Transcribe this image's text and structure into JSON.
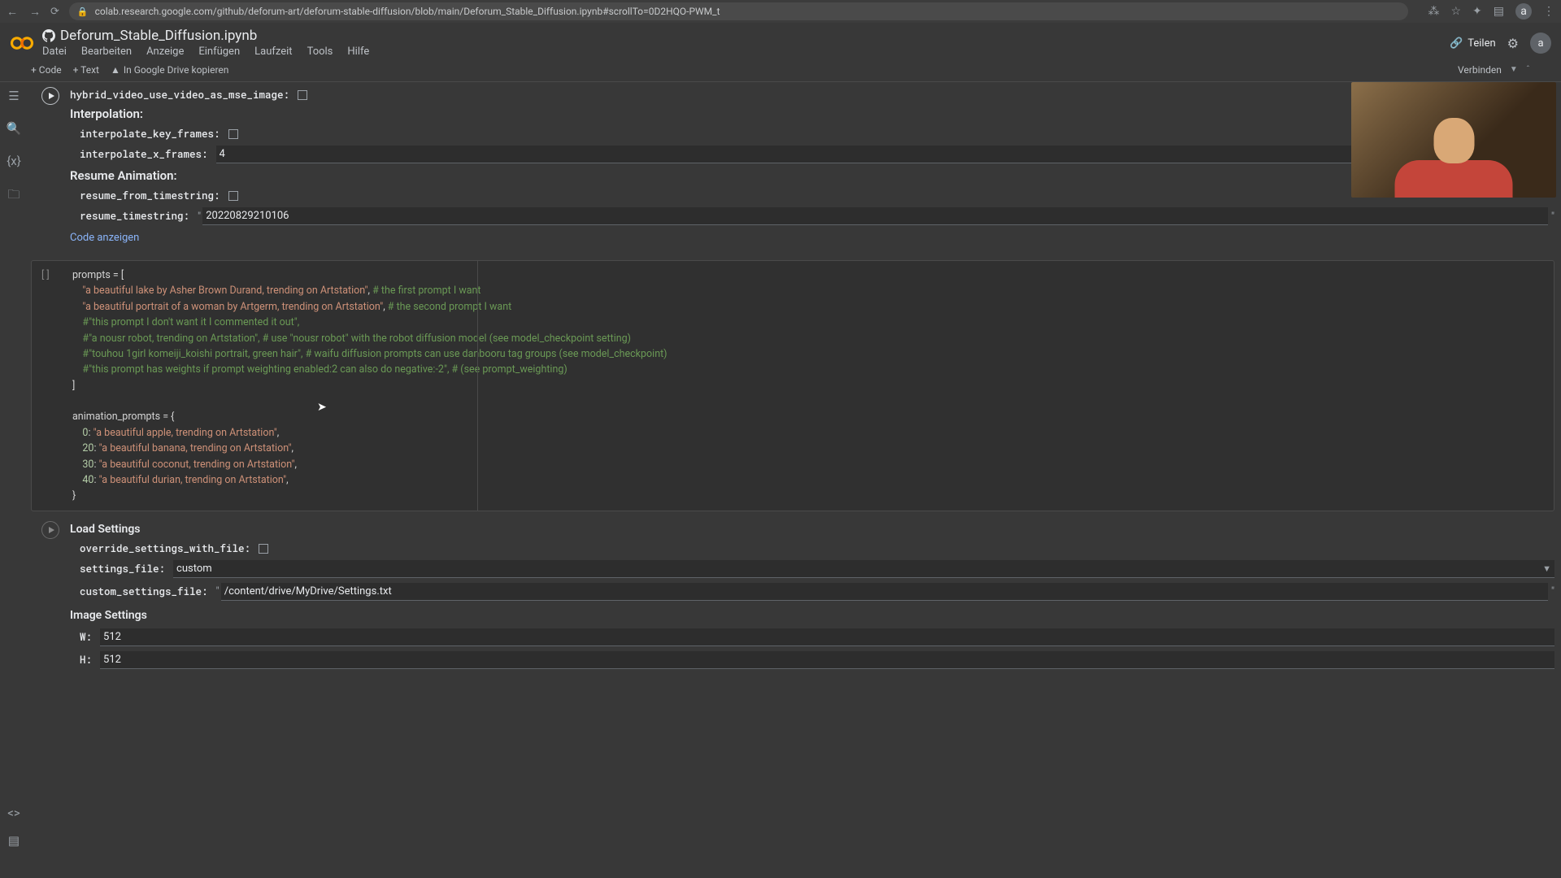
{
  "browser": {
    "url": "colab.research.google.com/github/deforum-art/deforum-stable-diffusion/blob/main/Deforum_Stable_Diffusion.ipynb#scrollTo=0D2HQO-PWM_t",
    "avatar": "a"
  },
  "colab": {
    "title": "Deforum_Stable_Diffusion.ipynb",
    "menu": [
      "Datei",
      "Bearbeiten",
      "Anzeige",
      "Einfügen",
      "Laufzeit",
      "Tools",
      "Hilfe"
    ],
    "share": "Teilen",
    "avatar": "a"
  },
  "toolbar": {
    "code": "+ Code",
    "text": "+ Text",
    "copy_drive": "In Google Drive kopieren",
    "connect": "Verbinden"
  },
  "form1": {
    "hybrid_label": "hybrid_video_use_video_as_mse_image:",
    "interpolation_heading": "Interpolation:",
    "interpolate_key_frames_label": "interpolate_key_frames:",
    "interpolate_x_frames_label": "interpolate_x_frames:",
    "interpolate_x_frames_value": "4",
    "resume_heading": "Resume Animation:",
    "resume_from_timestring_label": "resume_from_timestring:",
    "resume_timestring_label": "resume_timestring:",
    "resume_timestring_value": "20220829210106",
    "code_link": "Code anzeigen"
  },
  "code_cell": {
    "gutter": "[ ]",
    "l1a": "prompts ",
    "l1b": "=",
    "l1c": " [",
    "l2a": "\"a beautiful lake by Asher Brown Durand, trending on Artstation\"",
    "l2b": ", ",
    "l2c": "# the first prompt I want",
    "l3a": "\"a beautiful portrait of a woman by Artgerm, trending on Artstation\"",
    "l3b": ", ",
    "l3c": "# the second prompt I want",
    "l4": "#\"this prompt I don't want it I commented it out\",",
    "l5": "#\"a nousr robot, trending on Artstation\", # use \"nousr robot\" with the robot diffusion model (see model_checkpoint setting)",
    "l6": "#\"touhou 1girl komeiji_koishi portrait, green hair\", # waifu diffusion prompts can use danbooru tag groups (see model_checkpoint)",
    "l7": "#\"this prompt has weights if prompt weighting enabled:2 can also do negative:-2\", # (see prompt_weighting)",
    "l8": "]",
    "l10a": "animation_prompts ",
    "l10b": "=",
    "l10c": " {",
    "l11a": "0",
    "l11b": ": ",
    "l11c": "\"a beautiful apple, trending on Artstation\"",
    "l11d": ",",
    "l12a": "20",
    "l12b": ": ",
    "l12c": "\"a beautiful banana, trending on Artstation\"",
    "l12d": ",",
    "l13a": "30",
    "l13b": ": ",
    "l13c": "\"a beautiful coconut, trending on Artstation\"",
    "l13d": ",",
    "l14a": "40",
    "l14b": ": ",
    "l14c": "\"a beautiful durian, trending on Artstation\"",
    "l14d": ",",
    "l15": "}"
  },
  "form2": {
    "load_heading": "Load Settings",
    "override_label": "override_settings_with_file:",
    "settings_file_label": "settings_file:",
    "settings_file_value": "custom",
    "custom_settings_label": "custom_settings_file:",
    "custom_settings_value": "/content/drive/MyDrive/Settings.txt",
    "image_heading": "Image Settings",
    "w_label": "W:",
    "w_value": "512",
    "h_label": "H:",
    "h_value": "512"
  }
}
